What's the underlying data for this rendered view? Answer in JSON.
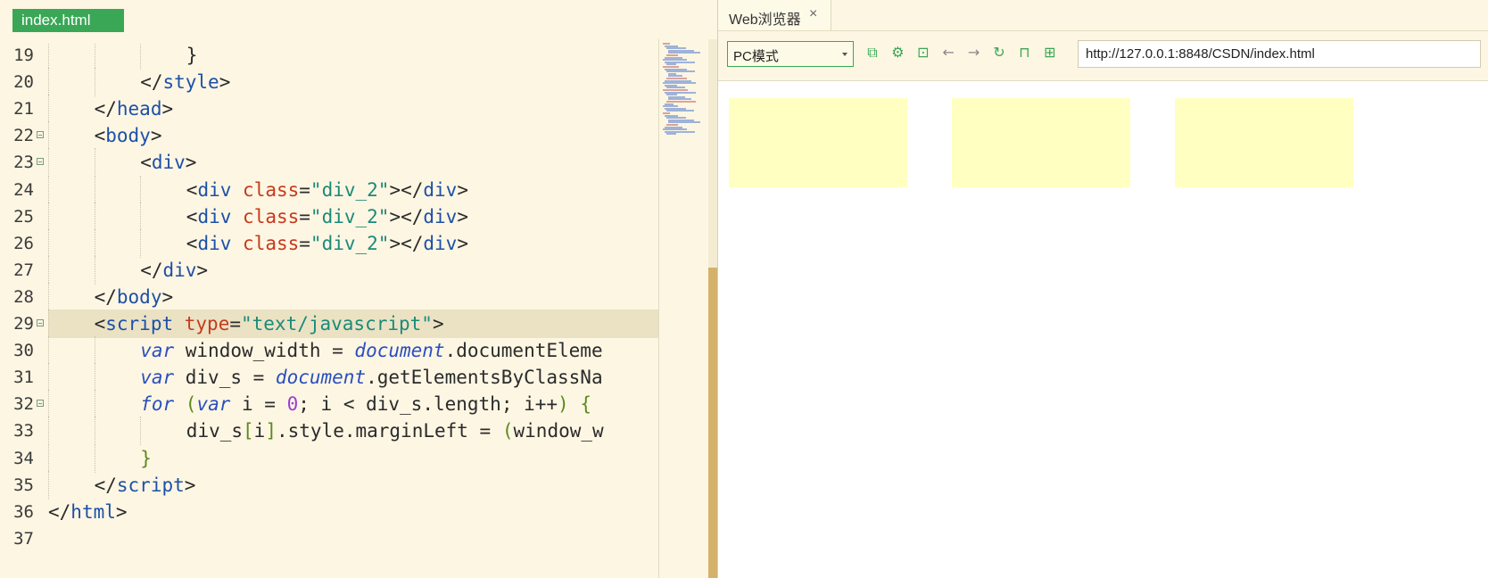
{
  "editor": {
    "file_tab": "index.html",
    "lines": [
      {
        "num": "19",
        "fold": false,
        "indent": 3,
        "tokens": [
          {
            "t": "}",
            "c": "t-punc"
          }
        ]
      },
      {
        "num": "20",
        "fold": false,
        "indent": 2,
        "tokens": [
          {
            "t": "</",
            "c": "t-punc"
          },
          {
            "t": "style",
            "c": "t-tag"
          },
          {
            "t": ">",
            "c": "t-punc"
          }
        ]
      },
      {
        "num": "21",
        "fold": false,
        "indent": 1,
        "tokens": [
          {
            "t": "</",
            "c": "t-punc"
          },
          {
            "t": "head",
            "c": "t-tag"
          },
          {
            "t": ">",
            "c": "t-punc"
          }
        ]
      },
      {
        "num": "22",
        "fold": true,
        "indent": 1,
        "tokens": [
          {
            "t": "<",
            "c": "t-punc"
          },
          {
            "t": "body",
            "c": "t-tag"
          },
          {
            "t": ">",
            "c": "t-punc"
          }
        ]
      },
      {
        "num": "23",
        "fold": true,
        "indent": 2,
        "tokens": [
          {
            "t": "<",
            "c": "t-punc"
          },
          {
            "t": "div",
            "c": "t-tag"
          },
          {
            "t": ">",
            "c": "t-punc"
          }
        ]
      },
      {
        "num": "24",
        "fold": false,
        "indent": 3,
        "tokens": [
          {
            "t": "<",
            "c": "t-punc"
          },
          {
            "t": "div",
            "c": "t-tag"
          },
          {
            "t": " ",
            "c": "t-plain"
          },
          {
            "t": "class",
            "c": "t-attr"
          },
          {
            "t": "=",
            "c": "t-punc"
          },
          {
            "t": "\"div_2\"",
            "c": "t-str"
          },
          {
            "t": "></",
            "c": "t-punc"
          },
          {
            "t": "div",
            "c": "t-tag"
          },
          {
            "t": ">",
            "c": "t-punc"
          }
        ]
      },
      {
        "num": "25",
        "fold": false,
        "indent": 3,
        "tokens": [
          {
            "t": "<",
            "c": "t-punc"
          },
          {
            "t": "div",
            "c": "t-tag"
          },
          {
            "t": " ",
            "c": "t-plain"
          },
          {
            "t": "class",
            "c": "t-attr"
          },
          {
            "t": "=",
            "c": "t-punc"
          },
          {
            "t": "\"div_2\"",
            "c": "t-str"
          },
          {
            "t": "></",
            "c": "t-punc"
          },
          {
            "t": "div",
            "c": "t-tag"
          },
          {
            "t": ">",
            "c": "t-punc"
          }
        ]
      },
      {
        "num": "26",
        "fold": false,
        "indent": 3,
        "tokens": [
          {
            "t": "<",
            "c": "t-punc"
          },
          {
            "t": "div",
            "c": "t-tag"
          },
          {
            "t": " ",
            "c": "t-plain"
          },
          {
            "t": "class",
            "c": "t-attr"
          },
          {
            "t": "=",
            "c": "t-punc"
          },
          {
            "t": "\"div_2\"",
            "c": "t-str"
          },
          {
            "t": "></",
            "c": "t-punc"
          },
          {
            "t": "div",
            "c": "t-tag"
          },
          {
            "t": ">",
            "c": "t-punc"
          }
        ]
      },
      {
        "num": "27",
        "fold": false,
        "indent": 2,
        "tokens": [
          {
            "t": "</",
            "c": "t-punc"
          },
          {
            "t": "div",
            "c": "t-tag"
          },
          {
            "t": ">",
            "c": "t-punc"
          }
        ]
      },
      {
        "num": "28",
        "fold": false,
        "indent": 1,
        "tokens": [
          {
            "t": "</",
            "c": "t-punc"
          },
          {
            "t": "body",
            "c": "t-tag"
          },
          {
            "t": ">",
            "c": "t-punc"
          }
        ]
      },
      {
        "num": "29",
        "fold": true,
        "indent": 1,
        "current": true,
        "tokens": [
          {
            "t": "<",
            "c": "t-punc"
          },
          {
            "t": "script",
            "c": "t-tag"
          },
          {
            "t": " ",
            "c": "t-plain"
          },
          {
            "t": "type",
            "c": "t-attr"
          },
          {
            "t": "=",
            "c": "t-punc"
          },
          {
            "t": "\"text/javascript\"",
            "c": "t-str"
          },
          {
            "t": ">",
            "c": "t-punc"
          }
        ]
      },
      {
        "num": "30",
        "fold": false,
        "indent": 2,
        "tokens": [
          {
            "t": "var",
            "c": "t-kw"
          },
          {
            "t": " window_width = ",
            "c": "t-plain"
          },
          {
            "t": "document",
            "c": "t-obj"
          },
          {
            "t": ".documentEleme",
            "c": "t-plain"
          }
        ]
      },
      {
        "num": "31",
        "fold": false,
        "indent": 2,
        "tokens": [
          {
            "t": "var",
            "c": "t-kw"
          },
          {
            "t": " div_s = ",
            "c": "t-plain"
          },
          {
            "t": "document",
            "c": "t-obj"
          },
          {
            "t": ".getElementsByClassNa",
            "c": "t-plain"
          }
        ]
      },
      {
        "num": "32",
        "fold": true,
        "indent": 2,
        "tokens": [
          {
            "t": "for",
            "c": "t-kw"
          },
          {
            "t": " ",
            "c": "t-plain"
          },
          {
            "t": "(",
            "c": "t-br"
          },
          {
            "t": "var",
            "c": "t-kw"
          },
          {
            "t": " i = ",
            "c": "t-plain"
          },
          {
            "t": "0",
            "c": "t-num"
          },
          {
            "t": "; i < div_s.length; i++",
            "c": "t-plain"
          },
          {
            "t": ")",
            "c": "t-br"
          },
          {
            "t": " ",
            "c": "t-plain"
          },
          {
            "t": "{",
            "c": "t-br"
          }
        ]
      },
      {
        "num": "33",
        "fold": false,
        "indent": 3,
        "tokens": [
          {
            "t": "div_s",
            "c": "t-plain"
          },
          {
            "t": "[",
            "c": "t-br"
          },
          {
            "t": "i",
            "c": "t-plain"
          },
          {
            "t": "]",
            "c": "t-br"
          },
          {
            "t": ".style.marginLeft = ",
            "c": "t-plain"
          },
          {
            "t": "(",
            "c": "t-br"
          },
          {
            "t": "window_w",
            "c": "t-plain"
          }
        ]
      },
      {
        "num": "34",
        "fold": false,
        "indent": 2,
        "tokens": [
          {
            "t": "}",
            "c": "t-br"
          }
        ]
      },
      {
        "num": "35",
        "fold": false,
        "indent": 1,
        "tokens": [
          {
            "t": "</",
            "c": "t-punc"
          },
          {
            "t": "script",
            "c": "t-tag"
          },
          {
            "t": ">",
            "c": "t-punc"
          }
        ]
      },
      {
        "num": "36",
        "fold": false,
        "indent": 0,
        "tokens": [
          {
            "t": "</",
            "c": "t-punc"
          },
          {
            "t": "html",
            "c": "t-tag"
          },
          {
            "t": ">",
            "c": "t-punc"
          }
        ]
      },
      {
        "num": "37",
        "fold": false,
        "indent": 0,
        "tokens": []
      }
    ]
  },
  "browser": {
    "tab_label": "Web浏览器",
    "tab_close": "×",
    "mode_value": "PC模式",
    "url": "http://127.0.0.1:8848/CSDN/index.html",
    "toolbar_icons": [
      {
        "name": "open-external-icon",
        "glyph": "⧉",
        "gray": false
      },
      {
        "name": "settings-icon",
        "glyph": "⚙",
        "gray": false
      },
      {
        "name": "console-icon",
        "glyph": "⊡",
        "gray": false
      },
      {
        "name": "back-icon",
        "glyph": "←",
        "gray": true
      },
      {
        "name": "forward-icon",
        "glyph": "→",
        "gray": true
      },
      {
        "name": "refresh-icon",
        "glyph": "↻",
        "gray": false
      },
      {
        "name": "lock-icon",
        "glyph": "⊓",
        "gray": false
      },
      {
        "name": "qrcode-icon",
        "glyph": "⊞",
        "gray": false
      }
    ],
    "page_boxes_color": "#ffffc2",
    "page_boxes_count": 3
  }
}
